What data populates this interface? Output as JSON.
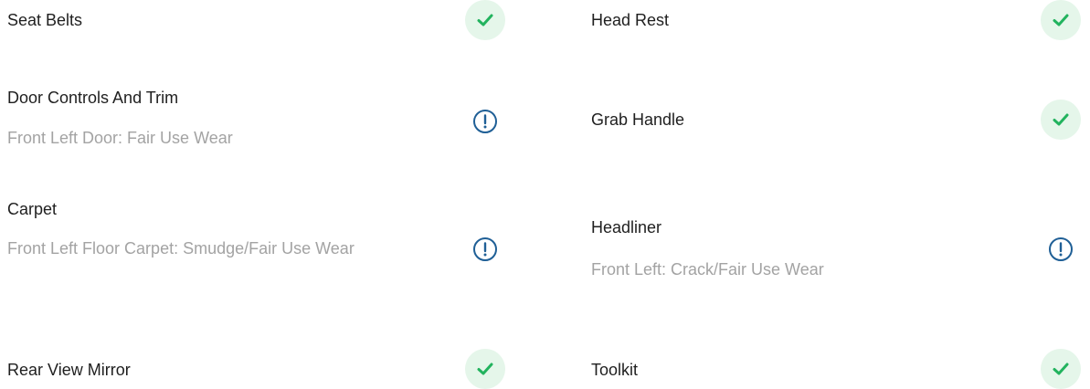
{
  "inspection": {
    "left": [
      {
        "title": "Seat Belts",
        "note": "",
        "status": "ok"
      },
      {
        "title": "Door Controls And Trim",
        "note": "Front Left Door: Fair Use Wear",
        "status": "warning"
      },
      {
        "title": "Carpet",
        "note": "Front Left Floor Carpet: Smudge/Fair Use Wear",
        "status": "warning"
      },
      {
        "title": "Rear View Mirror",
        "note": "",
        "status": "ok"
      }
    ],
    "right": [
      {
        "title": "Head Rest",
        "note": "",
        "status": "ok"
      },
      {
        "title": "Grab Handle",
        "note": "",
        "status": "ok"
      },
      {
        "title": "Headliner",
        "note": "Front Left: Crack/Fair Use Wear",
        "status": "warning"
      },
      {
        "title": "Toolkit",
        "note": "",
        "status": "ok"
      }
    ]
  },
  "colors": {
    "ok_icon": "#22b35e",
    "ok_bg": "#e5f6ea",
    "warning_icon": "#1f5f96",
    "title_text": "#1f1f1f",
    "note_text": "#a3a3a3"
  }
}
